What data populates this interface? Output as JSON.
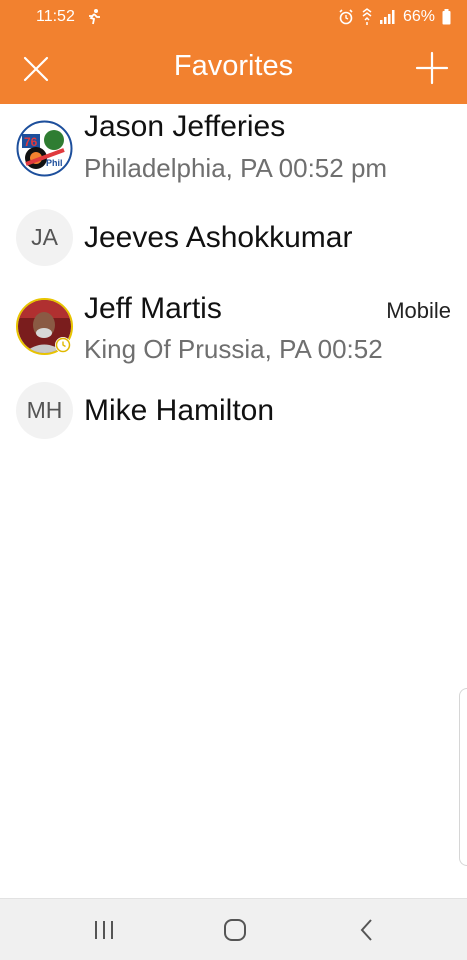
{
  "status_bar": {
    "time": "11:52",
    "battery": "66%",
    "icons": [
      "running-icon",
      "alarm-icon",
      "wifi-calling-icon",
      "signal-icon",
      "battery-icon"
    ]
  },
  "header": {
    "title": "Favorites",
    "close_icon": "close-icon",
    "add_icon": "plus-icon",
    "color": "#f2812f"
  },
  "favorites": [
    {
      "name": "Jason Jefferies",
      "subtitle": "Philadelphia, PA 00:52 pm",
      "avatar": "team-logo-photo"
    },
    {
      "name": "Jeeves Ashokkumar",
      "initials": "JA"
    },
    {
      "name": "Jeff Martis",
      "subtitle": "King Of Prussia, PA 00:52",
      "tag": "Mobile",
      "avatar": "person-photo",
      "status_icon": "clock-icon"
    },
    {
      "name": "Mike Hamilton",
      "initials": "MH"
    }
  ],
  "nav_bar": {
    "buttons": [
      "recent-apps-icon",
      "home-icon",
      "back-icon"
    ]
  }
}
